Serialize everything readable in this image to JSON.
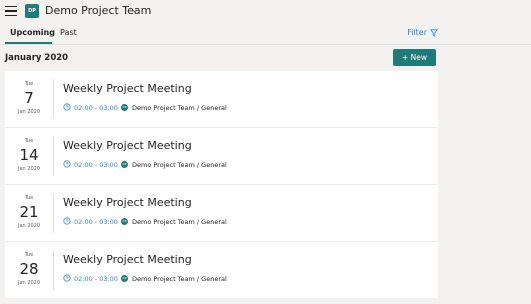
{
  "header": {
    "team_avatar_initials": "DP",
    "team_name": "Demo Project Team",
    "chevron_icon": "chevron-down-icon",
    "menu_icon": "hamburger-icon",
    "accent_color": "#1f7a7a"
  },
  "tabs": {
    "upcoming": "Upcoming",
    "past": "Past",
    "selected": "Upcoming"
  },
  "filter": {
    "label": "Filter",
    "icon": "filter-icon",
    "color": "#2b88d8"
  },
  "month_heading": "January 2020",
  "new_button": {
    "label": "+ New"
  },
  "events": [
    {
      "dow": "Tue",
      "day": "7",
      "monyr": "Jan 2020",
      "title": "Weekly Project Meeting",
      "time": "02:00 - 03:00",
      "channel_avatar": "DP",
      "channel": "Demo Project Team / General"
    },
    {
      "dow": "Tue",
      "day": "14",
      "monyr": "Jan 2020",
      "title": "Weekly Project Meeting",
      "time": "02:00 - 03:00",
      "channel_avatar": "DP",
      "channel": "Demo Project Team / General"
    },
    {
      "dow": "Tue",
      "day": "21",
      "monyr": "Jan 2020",
      "title": "Weekly Project Meeting",
      "time": "02:00 - 03:00",
      "channel_avatar": "DP",
      "channel": "Demo Project Team / General"
    },
    {
      "dow": "Tue",
      "day": "28",
      "monyr": "Jan 2020",
      "title": "Weekly Project Meeting",
      "time": "02:00 - 03:00",
      "channel_avatar": "DP",
      "channel": "Demo Project Team / General"
    }
  ]
}
